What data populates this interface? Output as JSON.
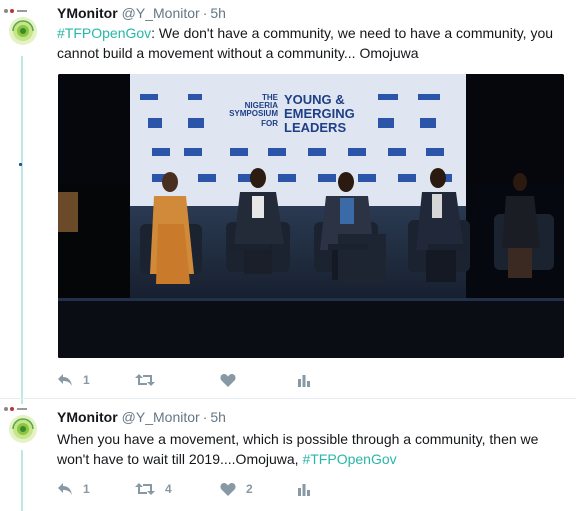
{
  "tweets": [
    {
      "name": "YMonitor",
      "handle": "@Y_Monitor",
      "separator": "·",
      "time": "5h",
      "hashtag": "#TFPOpenGov",
      "body": ": We don't have a community, we need to have a community, you cannot build a movement without a community... Omojuwa",
      "media_banner": {
        "line1": "THE",
        "line2": "NIGERIA",
        "line3": "SYMPOSIUM",
        "line4": "FOR",
        "title1": "YOUNG &",
        "title2": "EMERGING",
        "title3": "LEADERS"
      },
      "reply_count": "1",
      "retweet_count": "",
      "like_count": ""
    },
    {
      "name": "YMonitor",
      "handle": "@Y_Monitor",
      "separator": "·",
      "time": "5h",
      "body": "When you have a movement, which is possible through a community, then we won't have to wait till 2019....Omojuwa, ",
      "hashtag": "#TFPOpenGov",
      "reply_count": "1",
      "retweet_count": "4",
      "like_count": "2"
    }
  ],
  "colors": {
    "hashtag": "#27b7a8",
    "icon": "#8899a6",
    "thread_line": "#bde8e4"
  }
}
